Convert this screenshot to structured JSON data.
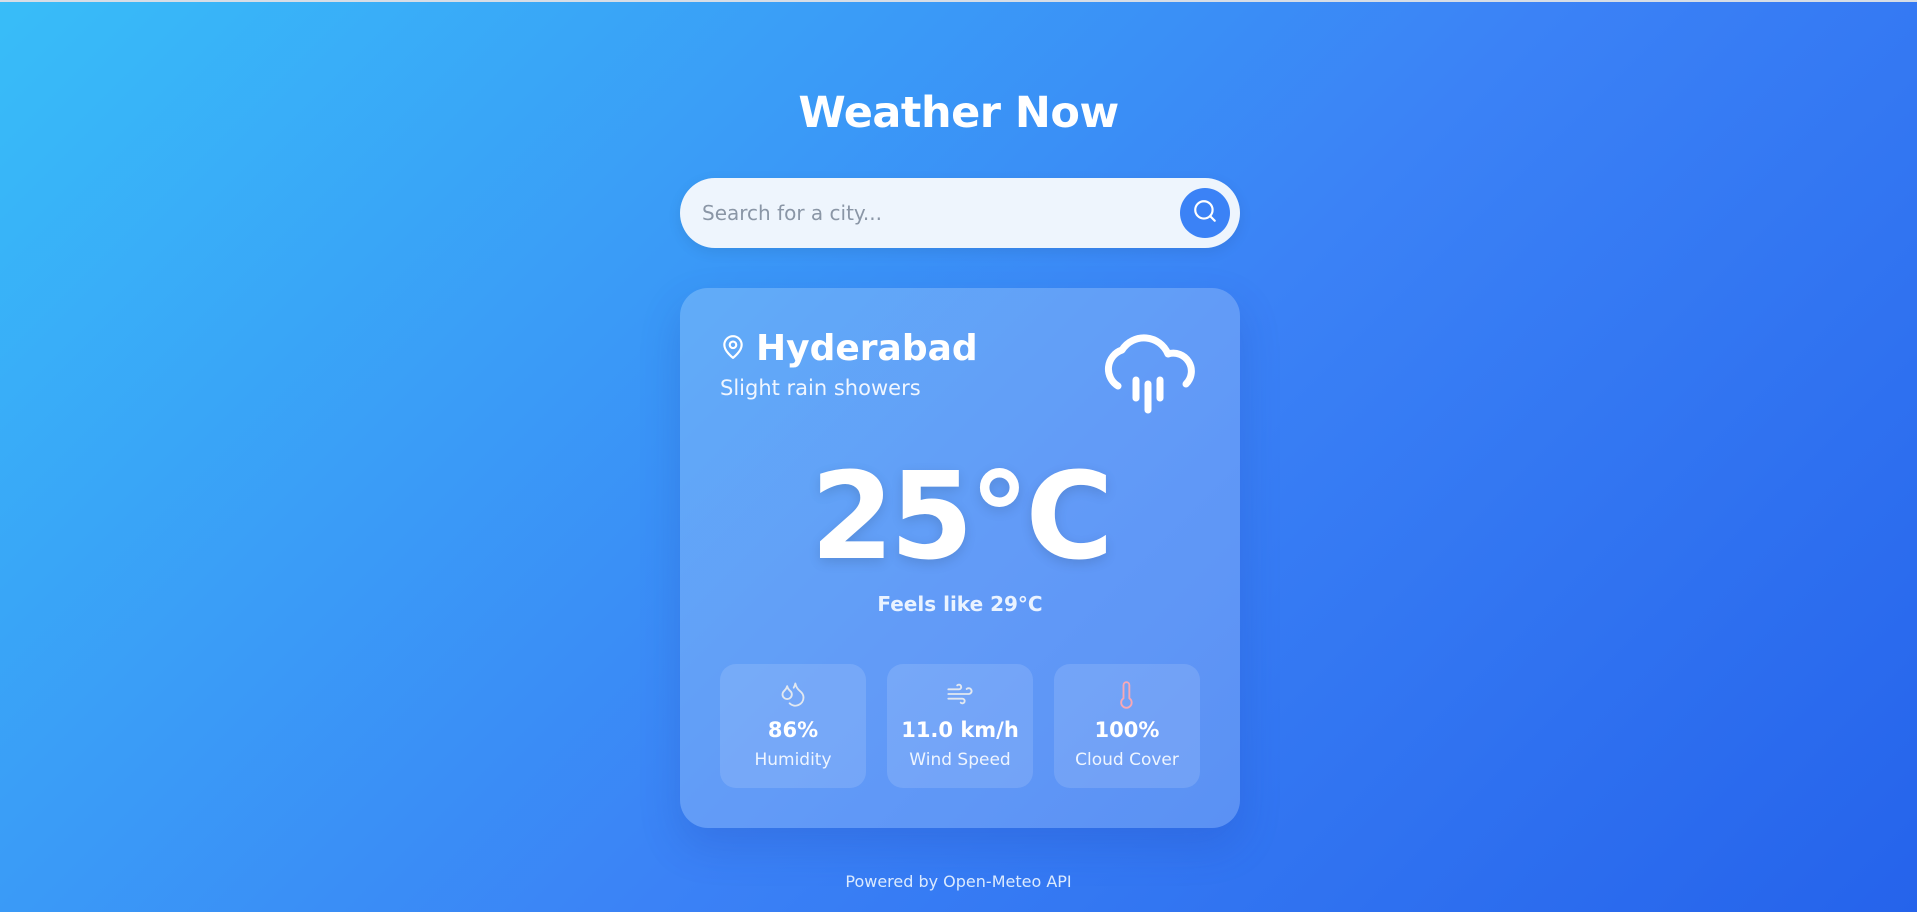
{
  "header": {
    "title": "Weather Now"
  },
  "search": {
    "placeholder": "Search for a city...",
    "icon": "search-icon"
  },
  "weather": {
    "city": "Hyderabad",
    "condition": "Slight rain showers",
    "condition_icon": "rain-cloud-icon",
    "temperature": "25°C",
    "feels_like": "Feels like 29°C",
    "stats": [
      {
        "value": "86%",
        "label": "Humidity",
        "icon": "droplets-icon"
      },
      {
        "value": "11.0 km/h",
        "label": "Wind Speed",
        "icon": "wind-icon"
      },
      {
        "value": "100%",
        "label": "Cloud Cover",
        "icon": "thermometer-icon"
      }
    ]
  },
  "footer": {
    "text": "Powered by Open-Meteo API"
  },
  "colors": {
    "background_start": "#38bdf8",
    "background_end": "#2563eb",
    "accent": "#3b82f6",
    "search_bg": "#eef5fd"
  }
}
